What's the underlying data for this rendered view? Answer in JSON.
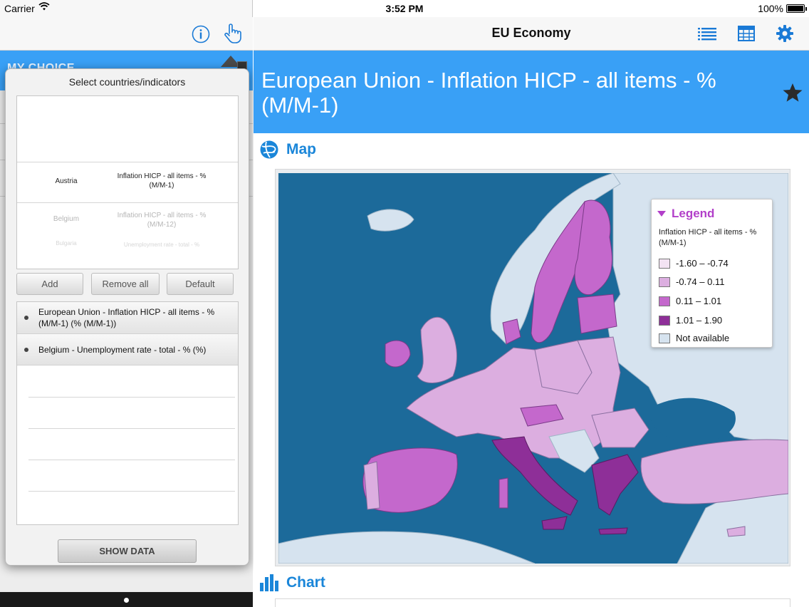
{
  "status_bar": {
    "carrier": "Carrier",
    "time": "3:52 PM",
    "battery": "100%"
  },
  "left_pane": {
    "section_label": "MY CHOICE",
    "popover": {
      "title": "Select countries/indicators",
      "picker_rows": [
        {
          "country": "Austria",
          "indicator": "Inflation HICP - all items - % (M/M-1)"
        },
        {
          "country": "Belgium",
          "indicator": "Inflation HICP - all items - % (M/M-12)"
        },
        {
          "country": "Bulgaria",
          "indicator": "Unemployment rate - total - %"
        }
      ],
      "buttons": {
        "add": "Add",
        "remove_all": "Remove all",
        "default": "Default"
      },
      "selected": [
        "European Union - Inflation HICP - all items - % (M/M-1) (% (M/M-1))",
        "Belgium - Unemployment rate - total - % (%)"
      ],
      "show_data": "SHOW DATA"
    }
  },
  "right_pane": {
    "nav_title": "EU Economy",
    "banner_title": "European Union - Inflation HICP - all items - % (M/M-1)",
    "map_section": "Map",
    "chart_section": "Chart",
    "legend": {
      "title": "Legend",
      "subtitle": "Inflation HICP - all items - % (M/M-1)",
      "items": [
        {
          "label": "-1.60 – -0.74",
          "color": "#f3e3f3"
        },
        {
          "label": "-0.74 – 0.11",
          "color": "#dcaee0"
        },
        {
          "label": "0.11 – 1.01",
          "color": "#c468cc"
        },
        {
          "label": "1.01 – 1.90",
          "color": "#8e2f98"
        },
        {
          "label": "Not available",
          "color": "#d6e3ef"
        }
      ]
    }
  },
  "colors": {
    "accent_blue": "#39a0f6",
    "link_blue": "#1a86d9",
    "sea": "#1c6a9a"
  }
}
